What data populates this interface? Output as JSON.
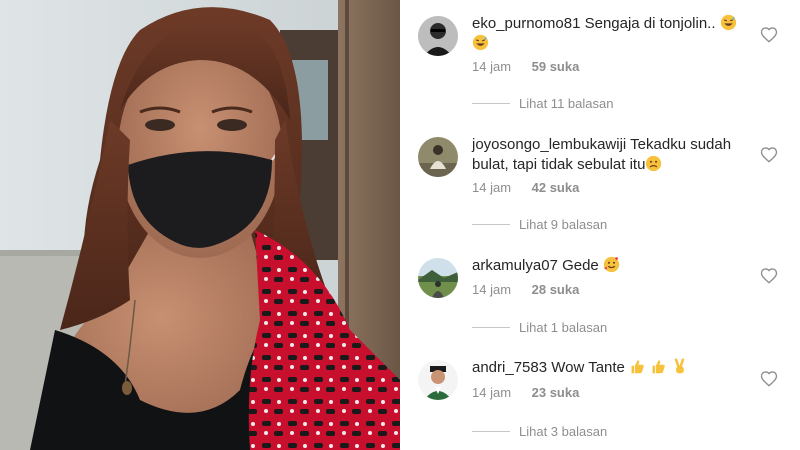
{
  "comments": [
    {
      "username": "eko_purnomo81",
      "text": "Sengaja di tonjolin..",
      "emoji_after": [
        "grinning-sweat-emoji",
        "grinning-sweat-emoji"
      ],
      "time": "14 jam",
      "likes": "59 suka",
      "replies": "Lihat 11 balasan",
      "avatar": "man-in-sunglasses-avatar"
    },
    {
      "username": "joyosongo_lembukawiji",
      "text": "Tekadku sudah bulat, tapi tidak sebulat itu",
      "emoji_after": [
        "slightly-frowning-emoji"
      ],
      "time": "14 jam",
      "likes": "42 suka",
      "replies": "Lihat 9 balasan",
      "avatar": "seated-figure-avatar"
    },
    {
      "username": "arkamulya07",
      "text": "Gede",
      "emoji_after": [
        "smiling-hearts-emoji"
      ],
      "time": "14 jam",
      "likes": "28 suka",
      "replies": "Lihat 1 balasan",
      "avatar": "landscape-avatar"
    },
    {
      "username": "andri_7583",
      "text": "Wow Tante",
      "emoji_after": [
        "thumbs-up-emoji",
        "thumbs-up-emoji",
        "victory-hand-emoji"
      ],
      "time": "14 jam",
      "likes": "23 suka",
      "replies": "Lihat 3 balasan",
      "avatar": "man-with-cap-avatar"
    }
  ],
  "icons": {
    "like": "heart-outline-icon"
  },
  "colors": {
    "meta_text": "#8e8e8e",
    "main_text": "#262626",
    "emoji_yellow": "#f7c23b"
  }
}
